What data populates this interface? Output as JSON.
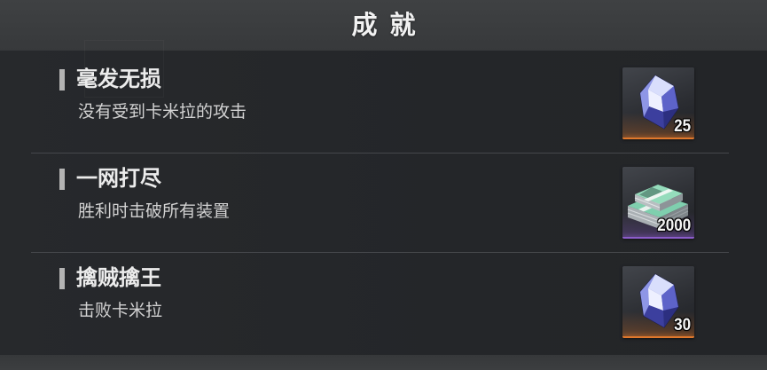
{
  "header": {
    "title": "成就"
  },
  "achievements": [
    {
      "title": "毫发无损",
      "description": "没有受到卡米拉的攻击",
      "reward": {
        "icon": "crystal-icon",
        "count": 25,
        "rarity_color": "#e0782c"
      }
    },
    {
      "title": "一网打尽",
      "description": "胜利时击破所有装置",
      "reward": {
        "icon": "money-stack-icon",
        "count": 2000,
        "rarity_color": "#8b5cc9"
      }
    },
    {
      "title": "擒贼擒王",
      "description": "击败卡米拉",
      "reward": {
        "icon": "crystal-icon",
        "count": 30,
        "rarity_color": "#e0782c"
      }
    }
  ],
  "colors": {
    "header_bg": "#3c3e40",
    "panel_bg": "#25272a",
    "text_primary": "#ececec",
    "text_secondary": "#d2d2d2"
  }
}
